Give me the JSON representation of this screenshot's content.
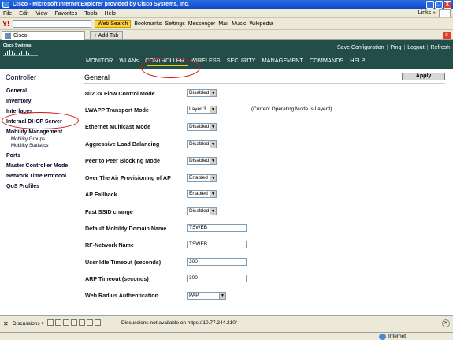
{
  "window": {
    "title": "Cisco - Microsoft Internet Explorer provided by Cisco Systems, Inc.",
    "min": "_",
    "max": "□",
    "close": "x"
  },
  "menu": {
    "items": [
      "File",
      "Edit",
      "View",
      "Favorites",
      "Tools",
      "Help"
    ],
    "links": "Links",
    "links_arrow": "»"
  },
  "toolbar": {
    "yahoo": "Y!",
    "web_search": "Web Search",
    "bookmarks": "Bookmarks",
    "settings": "Settings",
    "messenger": "Messenger",
    "mail": "Mail",
    "music": "Music",
    "wikipedia": "Wikipedia"
  },
  "tabs": {
    "current": "Cisco",
    "add": "Add Tab"
  },
  "header": {
    "logo": "Cisco Systems",
    "util": {
      "save": "Save Configuration",
      "ping": "Ping",
      "logout": "Logout",
      "refresh": "Refresh"
    },
    "nav": [
      "MONITOR",
      "WLANs",
      "CONTROLLER",
      "WIRELESS",
      "SECURITY",
      "MANAGEMENT",
      "COMMANDS",
      "HELP"
    ]
  },
  "sidebar": {
    "title": "Controller",
    "items": [
      "General",
      "Inventory",
      "Interfaces",
      "Internal DHCP Server",
      "Mobility Management",
      "Ports",
      "Master Controller Mode",
      "Network Time Protocol",
      "QoS Profiles"
    ],
    "subitems": [
      "Mobility Groups",
      "Mobility Statistics"
    ]
  },
  "main": {
    "title": "General",
    "apply": "Apply",
    "note": "(Current Operating Mode is Layer3)",
    "rows": [
      {
        "label": "802.3x Flow Control Mode",
        "value": "Disabled"
      },
      {
        "label": "LWAPP Transport Mode",
        "value": "Layer 3"
      },
      {
        "label": "Ethernet Multicast Mode",
        "value": "Disabled"
      },
      {
        "label": "Aggressive Load Balancing",
        "value": "Disabled"
      },
      {
        "label": "Peer to Peer Blocking Mode",
        "value": "Disabled"
      },
      {
        "label": "Over The Air Provisioning of AP",
        "value": "Enabled"
      },
      {
        "label": "AP Fallback",
        "value": "Enabled"
      },
      {
        "label": "Fast SSID change",
        "value": "Disabled"
      },
      {
        "label": "Default Mobility Domain Name",
        "value": "TSWEB"
      },
      {
        "label": "RF-Network Name",
        "value": "TSWEB"
      },
      {
        "label": "User Idle Timeout (seconds)",
        "value": "300"
      },
      {
        "label": "ARP Timeout (seconds)",
        "value": "300"
      },
      {
        "label": "Web Radius Authentication",
        "value": "PAP"
      }
    ]
  },
  "statusbar": {
    "discussions": "Discussions",
    "message": "Discussions not available on https://10.77.244.210/",
    "zone": "Internet"
  }
}
